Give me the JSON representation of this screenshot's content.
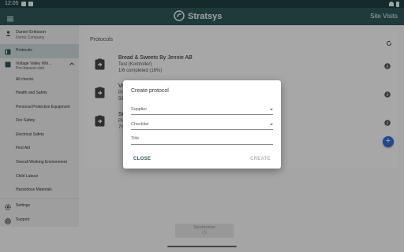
{
  "status_bar": {
    "time": "12:05",
    "icons": [
      "shield-icon",
      "sim-icon",
      "wifi-icon",
      "battery-icon"
    ]
  },
  "app_bar": {
    "brand": "Stratsys",
    "site_visits": "Site Visits",
    "menu_icon": "hamburger-icon"
  },
  "sidebar": {
    "user_name": "Daniel Eriksson",
    "company": "Demo Company",
    "protocols_label": "Protocols",
    "visit_title": "Voltage Valley Win...",
    "visit_sub": "Pre-harvest visit",
    "checks": [
      "All checks",
      "Health and Safety",
      "Personal Protective Equipment",
      "Fire Safety",
      "Electrical Safety",
      "First Aid",
      "Overall Working Environment",
      "Child Labour",
      "Hazardous Materials"
    ],
    "settings_label": "Settings",
    "support_label": "Support"
  },
  "main": {
    "title": "Protocols",
    "protocols": [
      {
        "title": "Bread & Sweets By Jennie AB",
        "sub": "Test (Kontroller)",
        "progress": "1/6 completed (16%)"
      },
      {
        "title": "Volt",
        "sub": "Pre",
        "progress": "59/5"
      },
      {
        "title": "Sol",
        "sub": "Plat",
        "progress": "7/99"
      }
    ],
    "fab_label": "+"
  },
  "bottom_bar": {
    "label": "Synchronize"
  },
  "dialog": {
    "title": "Create protocol",
    "supplier_label": "Supplier",
    "checklist_label": "Checklist",
    "title_placeholder": "Title",
    "close_label": "CLOSE",
    "create_label": "CREATE"
  },
  "colors": {
    "primary": "#2d5658",
    "status_bar": "#1f3f41",
    "fab": "#2f6bd0"
  }
}
